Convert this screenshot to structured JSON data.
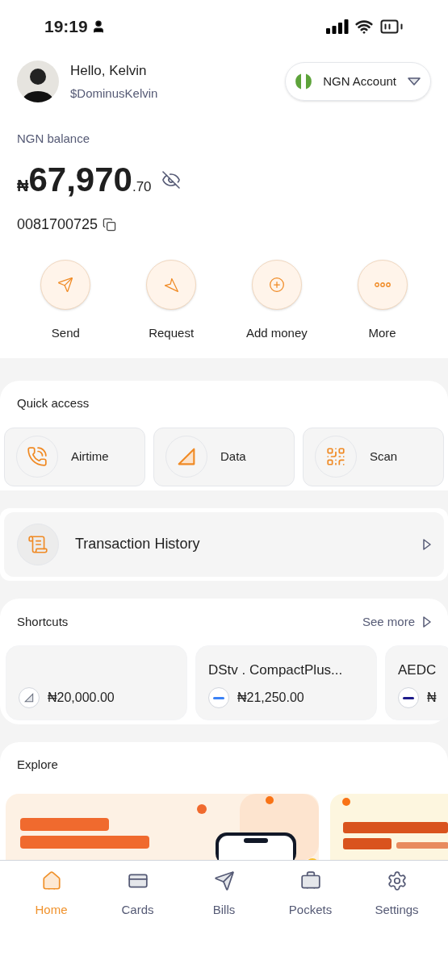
{
  "status_bar": {
    "time": "19:19"
  },
  "profile": {
    "greeting": "Hello, Kelvin",
    "handle": "$DominusKelvin"
  },
  "account_selector": {
    "label": "NGN Account"
  },
  "balance": {
    "label": "NGN balance",
    "currency": "₦",
    "whole": "67,970",
    "fraction": ".70",
    "account_number": "0081700725"
  },
  "actions": [
    {
      "label": "Send",
      "kind": "send"
    },
    {
      "label": "Request",
      "kind": "request"
    },
    {
      "label": "Add money",
      "kind": "add"
    },
    {
      "label": "More",
      "kind": "more"
    }
  ],
  "quick_access": {
    "title": "Quick access",
    "items": [
      {
        "label": "Airtime",
        "kind": "airtime"
      },
      {
        "label": "Data",
        "kind": "data"
      },
      {
        "label": "Scan",
        "kind": "scan"
      }
    ]
  },
  "transaction_history": {
    "label": "Transaction History"
  },
  "shortcuts": {
    "title": "Shortcuts",
    "see_more": "See more",
    "items": [
      {
        "amount": "₦20,000.00",
        "kind": "data"
      },
      {
        "title": "DStv . CompactPlus...",
        "amount": "₦21,250.00",
        "kind": "tv"
      },
      {
        "title": "AEDC",
        "amount": "₦",
        "kind": "power"
      }
    ]
  },
  "explore": {
    "title": "Explore"
  },
  "bottom_nav": [
    {
      "label": "Home",
      "kind": "home",
      "selected": true
    },
    {
      "label": "Cards",
      "kind": "cards",
      "selected": false
    },
    {
      "label": "Bills",
      "kind": "bills",
      "selected": false
    },
    {
      "label": "Pockets",
      "kind": "pockets",
      "selected": false
    },
    {
      "label": "Settings",
      "kind": "settings",
      "selected": false
    }
  ]
}
